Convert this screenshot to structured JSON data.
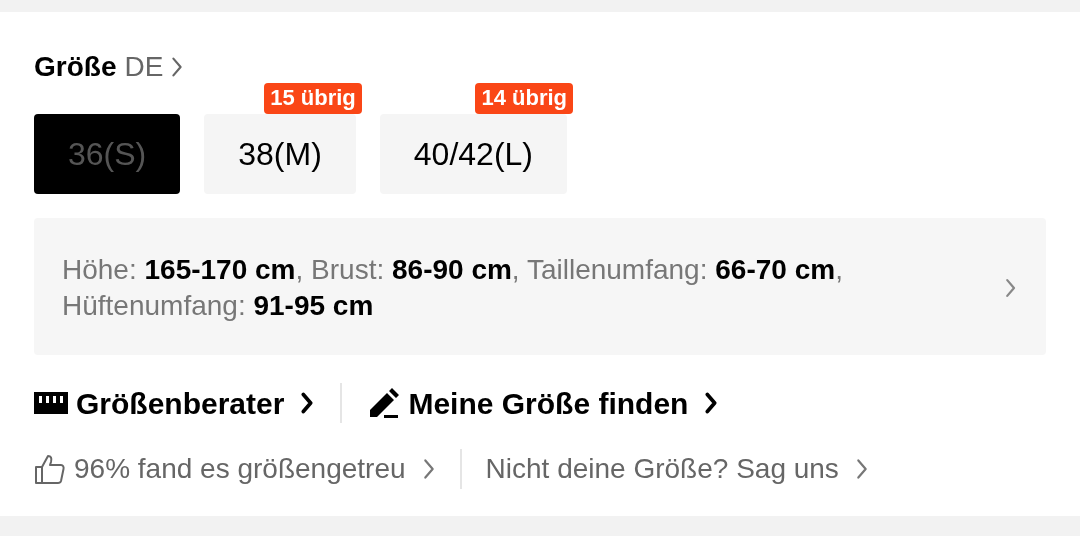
{
  "title": {
    "label": "Größe",
    "region": "DE"
  },
  "sizes": [
    {
      "label": "36(S)",
      "selected": true
    },
    {
      "label": "38(M)",
      "selected": false,
      "badge": "15 übrig"
    },
    {
      "label": "40/42(L)",
      "selected": false,
      "badge": "14 übrig"
    }
  ],
  "measurements": "Höhe: **165-170 cm**, Brust: **86-90 cm**, Taillenumfang: **66-70 cm**, Hüftenumfang: **91-95 cm**",
  "links": [
    {
      "kind": "ruler",
      "label": "Größenberater"
    },
    {
      "kind": "pencil",
      "label": "Meine Größe finden"
    }
  ],
  "feedback": [
    {
      "kind": "thumb",
      "label": "96% fand es größengetreu"
    },
    {
      "kind": "none",
      "label": "Nicht deine Größe? Sag uns"
    }
  ]
}
